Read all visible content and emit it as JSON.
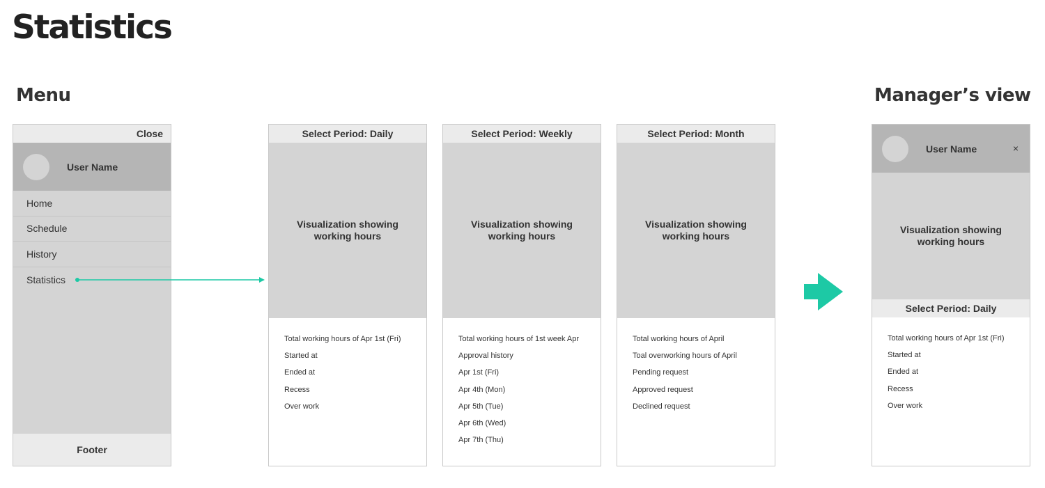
{
  "page_title": "Statistics",
  "sections": {
    "menu": "Menu",
    "manager": "Manager’s view"
  },
  "menu_panel": {
    "close_label": "Close",
    "user_name": "User Name",
    "items": [
      "Home",
      "Schedule",
      "History",
      "Statistics"
    ],
    "footer": "Footer"
  },
  "stat_panels": [
    {
      "period_label": "Select Period: Daily",
      "viz_text": "Visualization showing working hours",
      "items": [
        "Total working hours of Apr 1st (Fri)",
        "Started at",
        "Ended at",
        "Recess",
        "Over work"
      ]
    },
    {
      "period_label": "Select Period: Weekly",
      "viz_text": "Visualization showing working hours",
      "items": [
        "Total working hours of 1st week Apr",
        "Approval history",
        "Apr 1st (Fri)",
        "Apr 4th (Mon)",
        "Apr 5th (Tue)",
        "Apr 6th (Wed)",
        "Apr 7th (Thu)"
      ]
    },
    {
      "period_label": "Select Period: Month",
      "viz_text": "Visualization showing working hours",
      "items": [
        "Total working hours of April",
        "Toal overworking hours of April",
        "Pending request",
        "Approved request",
        "Declined request"
      ]
    }
  ],
  "manager_panel": {
    "user_name": "User Name",
    "close_icon": "×",
    "viz_text": "Visualization showing working hours",
    "period_label": "Select Period: Daily",
    "items": [
      "Total working hours of Apr 1st (Fri)",
      "Started at",
      "Ended at",
      "Recess",
      "Over work"
    ]
  },
  "colors": {
    "accent": "#1dc9a5",
    "bar_light": "#ebebeb",
    "placeholder": "#d4d4d4",
    "header_dark": "#b5b5b5"
  }
}
